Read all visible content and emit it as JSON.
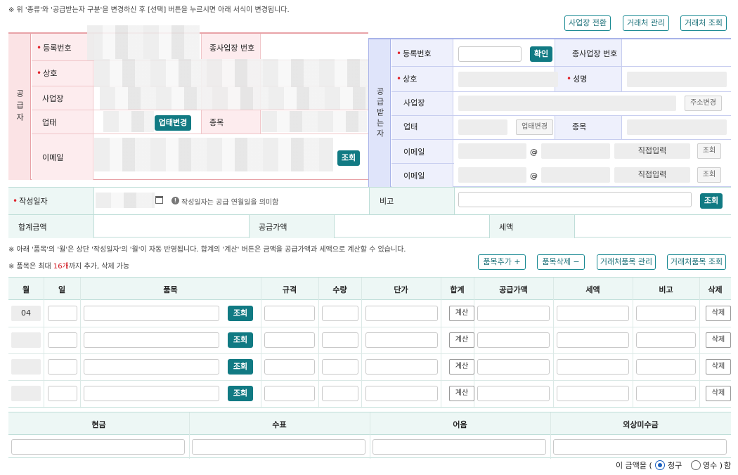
{
  "top_note": "※ 위 '종류'와 '공급받는자 구분'을 변경하신 후 [선택] 버튼을 누르시면 아래 서식이 변경됩니다.",
  "top_buttons": [
    "사업장 전환",
    "거래처 관리",
    "거래처 조회"
  ],
  "supplier": {
    "side_label": "공급자",
    "reg_no_label": "등록번호",
    "sub_biz_label": "종사업장 번호",
    "name_label": "상호",
    "biz_place_label": "사업장",
    "biz_type_label": "업태",
    "change_type_button": "업태변경",
    "item_label": "종목",
    "email_label": "이메일",
    "search_button": "조회"
  },
  "receiver": {
    "side_label": "공급받는자",
    "reg_no_label": "등록번호",
    "confirm_button": "확인",
    "sub_biz_label": "종사업장 번호",
    "name_label": "상호",
    "ceo_label": "성명",
    "biz_place_label": "사업장",
    "address_change_button": "주소변경",
    "biz_type_label": "업태",
    "change_type_button": "업태변경",
    "item_label": "종목",
    "email_label": "이메일",
    "at_sign": "@",
    "direct_input": "직접입력",
    "search_button": "조회"
  },
  "date_row": {
    "label": "작성일자",
    "hint": "작성일자는 공급 연월일을 의미함",
    "remark_label": "비고",
    "search_button": "조회"
  },
  "totals_row": {
    "total_label": "합계금액",
    "supply_label": "공급가액",
    "tax_label": "세액"
  },
  "notes": {
    "month_note": "※ 아래 '품목'의 '월'은 상단 '작성일자'의 '월'이 자동 반영됩니다. 합계의 '계산' 버튼은 금액을 공급가액과 세액으로 계산할 수 있습니다.",
    "max_prefix": "※ 품목은 최대 ",
    "max_count": "16개",
    "max_suffix": "까지 추가, 삭제 가능"
  },
  "item_buttons": [
    "품목추가 +",
    "품목삭제 −",
    "거래처품목 관리",
    "거래처품목 조회"
  ],
  "item_table": {
    "headers": [
      "월",
      "일",
      "품목",
      "규격",
      "수량",
      "단가",
      "합계",
      "공급가액",
      "세액",
      "비고",
      "삭제"
    ],
    "rows": [
      {
        "month": "04",
        "search": "조회",
        "calc": "계산",
        "delete": "삭제"
      },
      {
        "month": "",
        "search": "조회",
        "calc": "계산",
        "delete": "삭제"
      },
      {
        "month": "",
        "search": "조회",
        "calc": "계산",
        "delete": "삭제"
      },
      {
        "month": "",
        "search": "조회",
        "calc": "계산",
        "delete": "삭제"
      }
    ]
  },
  "payment_table": {
    "headers": [
      "현금",
      "수표",
      "어음",
      "외상미수금"
    ]
  },
  "footer": {
    "prefix": "이 금액을 (",
    "option_claim": "청구",
    "option_receipt": "영수 )",
    "suffix": "함",
    "selected": "청구"
  },
  "colors": {
    "supplier_bg": "#fdecee",
    "supplier_border": "#e8a3a8",
    "receiver_bg": "#e9edfb",
    "receiver_border": "#a8b3e8",
    "teal_button": "#117a83",
    "green_header": "#edf7f5"
  }
}
